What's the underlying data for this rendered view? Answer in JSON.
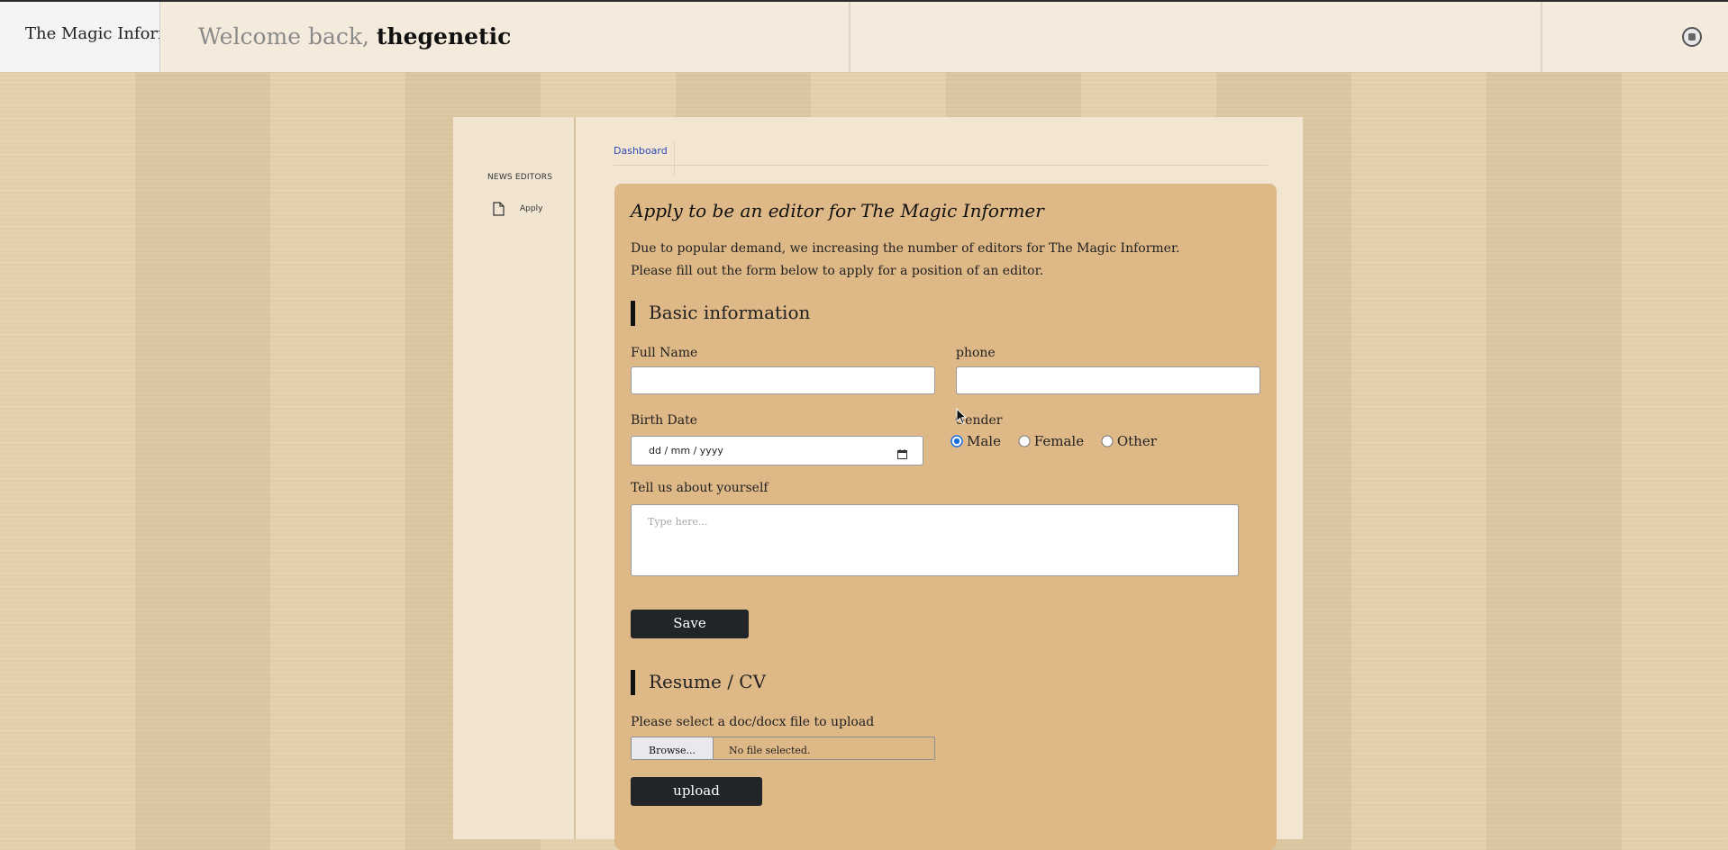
{
  "header": {
    "brand": "The Magic Informer",
    "welcome_prefix": "Welcome back,",
    "username": "thegenetic"
  },
  "sidebar": {
    "heading": "NEWS EDITORS",
    "items": [
      {
        "label": "Apply",
        "icon": "document-icon"
      }
    ]
  },
  "tabs": [
    {
      "label": "Dashboard"
    }
  ],
  "form": {
    "title": "Apply to be an editor for The Magic Informer",
    "intro_line1": "Due to popular demand, we increasing the number of editors for The Magic Informer.",
    "intro_line2": "Please fill out the form below to apply for a position of an editor.",
    "basic_section": "Basic information",
    "full_name_label": "Full Name",
    "full_name_value": "",
    "phone_label": "phone",
    "phone_value": "",
    "birth_date_label": "Birth Date",
    "birth_date_placeholder": "dd / mm / yyyy",
    "gender_label": "Gender",
    "gender_options": [
      "Male",
      "Female",
      "Other"
    ],
    "gender_selected": "Male",
    "about_label": "Tell us about yourself",
    "about_placeholder": "Type here...",
    "save_label": "Save",
    "resume_section": "Resume / CV",
    "file_label": "Please select a doc/docx file to upload",
    "browse_label": "Browse...",
    "file_status": "No file selected.",
    "upload_label": "upload"
  },
  "colors": {
    "card": "#deb887",
    "button": "#212529",
    "link": "#2f49b5",
    "radio_selected": "#1a6fe0"
  }
}
